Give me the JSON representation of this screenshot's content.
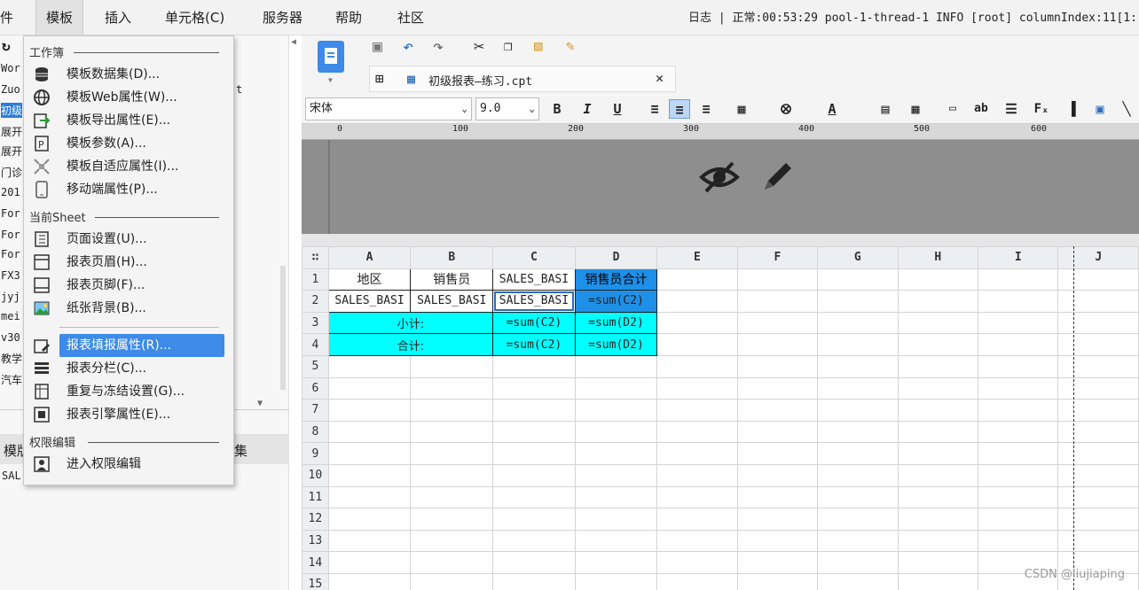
{
  "menubar": {
    "items": [
      "件",
      "模板",
      "插入",
      "单元格(C)",
      "服务器",
      "帮助",
      "社区"
    ],
    "log_text": "日志 | 正常:00:53:29 pool-1-thread-1 INFO [root] columnIndex:11[1:"
  },
  "left_panel": {
    "lines": [
      "Wor",
      "Zuo",
      "初级",
      "展开",
      "展开",
      "门诊",
      "201",
      "For",
      "For",
      "For",
      "FX3",
      "jyj",
      "mei",
      "v30",
      "教学",
      "汽车"
    ],
    "extra_t": "t",
    "bottom_label_1": "模版",
    "bottom_label_2": "SAL",
    "bottom_label_3": "集"
  },
  "template_menu": {
    "section_workbook": "工作簿",
    "section_sheet": "当前Sheet",
    "section_permission": "权限编辑",
    "items": [
      {
        "label": "模板数据集(D)...",
        "icon": "database-icon"
      },
      {
        "label": "模板Web属性(W)...",
        "icon": "globe-icon"
      },
      {
        "label": "模板导出属性(E)...",
        "icon": "export-icon"
      },
      {
        "label": "模板参数(A)...",
        "icon": "parameter-icon"
      },
      {
        "label": "模板自适应属性(I)...",
        "icon": "adaptive-icon"
      },
      {
        "label": "移动端属性(P)...",
        "icon": "mobile-icon"
      },
      {
        "label": "页面设置(U)...",
        "icon": "page-setup-icon"
      },
      {
        "label": "报表页眉(H)...",
        "icon": "header-icon"
      },
      {
        "label": "报表页脚(F)...",
        "icon": "footer-icon"
      },
      {
        "label": "纸张背景(B)...",
        "icon": "background-icon"
      },
      {
        "label": "报表填报属性(R)...",
        "icon": "fill-report-icon"
      },
      {
        "label": "报表分栏(C)...",
        "icon": "columns-icon"
      },
      {
        "label": "重复与冻结设置(G)...",
        "icon": "freeze-icon"
      },
      {
        "label": "报表引擎属性(E)...",
        "icon": "engine-icon"
      },
      {
        "label": "进入权限编辑",
        "icon": "permission-icon"
      }
    ]
  },
  "editor": {
    "tab_title": "初级报表—练习.cpt",
    "font_name": "宋体",
    "font_size": "9.0",
    "bold": "B",
    "italic": "I",
    "underline": "U",
    "ruler_ticks": [
      "0",
      "100",
      "200",
      "300",
      "400",
      "500",
      "600"
    ]
  },
  "sheet": {
    "col_headers": [
      "A",
      "B",
      "C",
      "D",
      "E",
      "F",
      "G",
      "H",
      "I",
      "J"
    ],
    "row_headers": [
      "1",
      "2",
      "3",
      "4",
      "5",
      "6",
      "7",
      "8",
      "9",
      "10",
      "11",
      "12",
      "13",
      "14",
      "15"
    ],
    "a1": "地区",
    "b1": "销售员",
    "c1": "SALES_BASI",
    "d1": "销售员合计",
    "a2": "SALES_BASI",
    "b2": "SALES_BASI",
    "c2": "SALES_BASI",
    "d2": "=sum(C2)",
    "ab3": "小计:",
    "c3": "=sum(C2)",
    "d3": "=sum(D2)",
    "ab4": "合计:",
    "c4": "=sum(C2)",
    "d4": "=sum(D2)"
  },
  "watermark": "CSDN @liujiaping"
}
